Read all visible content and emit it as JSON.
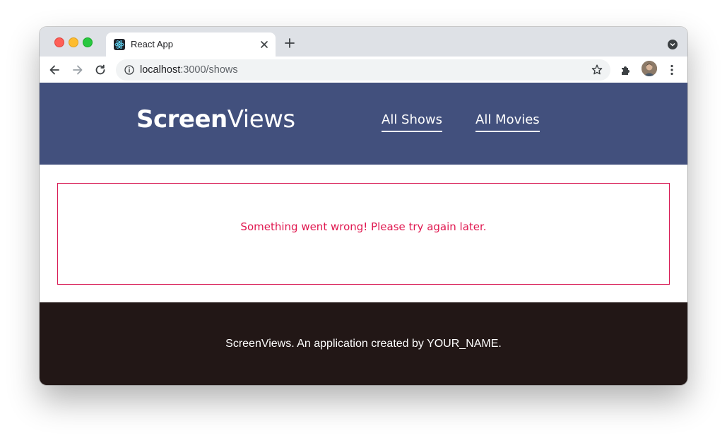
{
  "browser": {
    "tab_title": "React App",
    "url_host": "localhost",
    "url_path": ":3000/shows",
    "icons": [
      "react-favicon-icon",
      "close-icon",
      "plus-icon",
      "tab-search-icon",
      "back-arrow-icon",
      "forward-arrow-icon",
      "reload-icon",
      "info-icon",
      "star-icon",
      "puzzle-extension-icon",
      "avatar",
      "kebab-menu-icon"
    ]
  },
  "site": {
    "logo_bold": "Screen",
    "logo_light": "Views",
    "nav": [
      {
        "label": "All Shows"
      },
      {
        "label": "All Movies"
      }
    ],
    "error_message": "Something went wrong! Please try again later.",
    "footer_text": "ScreenViews. An application created by YOUR_NAME."
  },
  "colors": {
    "header_bg": "#42507d",
    "error_red": "#e0174f",
    "footer_bg": "#221716"
  }
}
